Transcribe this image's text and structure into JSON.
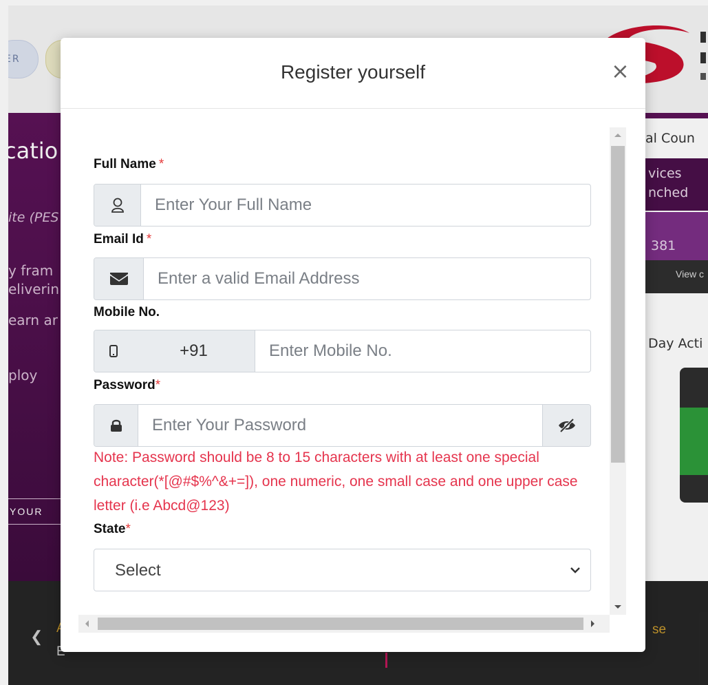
{
  "background": {
    "pill_1": "ER",
    "pill_2": "",
    "hero_title": "catio",
    "hero_italic": "ite (PES",
    "hero_line_1": "y fram",
    "hero_line_2": "eliverin",
    "hero_line_3": "earn ar",
    "hero_line_4": "ploy",
    "hero_button": "YOUR",
    "right_council": "al Coun",
    "right_services_1": "vices",
    "right_services_2": "nched",
    "right_number": "381",
    "right_view": "View c",
    "right_day": "Day Acti",
    "footer_left_1": "A",
    "footer_left_2": "E",
    "footer_right": "se"
  },
  "modal": {
    "title": "Register yourself",
    "close_label": "×",
    "fields": {
      "full_name": {
        "label": "Full Name",
        "required": "*",
        "placeholder": "Enter Your Full Name",
        "icon": "user-icon"
      },
      "email": {
        "label": "Email Id",
        "required": "*",
        "placeholder": "Enter a valid Email Address",
        "icon": "envelope-icon"
      },
      "mobile": {
        "label": "Mobile No.",
        "country_code": "+91",
        "placeholder": "Enter Mobile No.",
        "icon": "mobile-icon"
      },
      "password": {
        "label": "Password",
        "required": "*",
        "placeholder": "Enter Your Password",
        "icon": "lock-icon",
        "toggle_icon": "eye-slash-icon"
      },
      "state": {
        "label": "State",
        "required": "*",
        "selected": "Select"
      }
    },
    "password_note": "Note: Password should be 8 to 15 characters with at least one special character(*[@#$%^&+=]), one numeric, one small case and one upper case letter (i.e Abcd@123)"
  },
  "colors": {
    "required": "#e53939",
    "note": "#e5344d",
    "addon_bg": "#e9ecef",
    "purple": "#5c1358"
  }
}
